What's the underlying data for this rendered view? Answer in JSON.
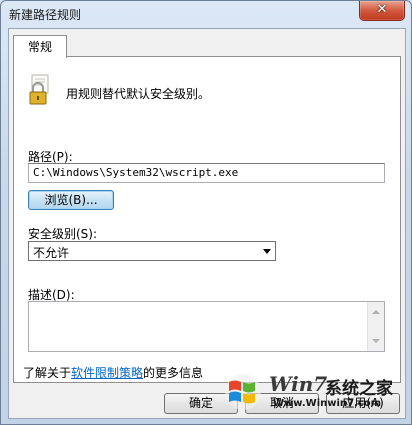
{
  "window": {
    "title": "新建路径规则",
    "close_glyph": "✕"
  },
  "tabs": [
    {
      "label": "常规"
    }
  ],
  "general": {
    "description": "用规则替代默认安全级别。",
    "path_label": "路径(P):",
    "path_value": "C:\\Windows\\System32\\wscript.exe",
    "browse_label": "浏览(B)...",
    "security_level_label": "安全级别(S):",
    "security_level_value": "不允许",
    "desc_label": "描述(D):",
    "desc_value": "",
    "learn_prefix": "了解关于",
    "learn_link": "软件限制策略",
    "learn_suffix": "的更多信息"
  },
  "footer": {
    "ok": "确定",
    "cancel": "取消",
    "apply": "应用(A)"
  },
  "watermark": {
    "brand": "Win7",
    "brand_cn": "系统之家",
    "url": "Www.Winwin7.com"
  },
  "icons": {
    "lock": "lock-icon",
    "close": "close-icon",
    "windows": "windows-logo-icon"
  }
}
